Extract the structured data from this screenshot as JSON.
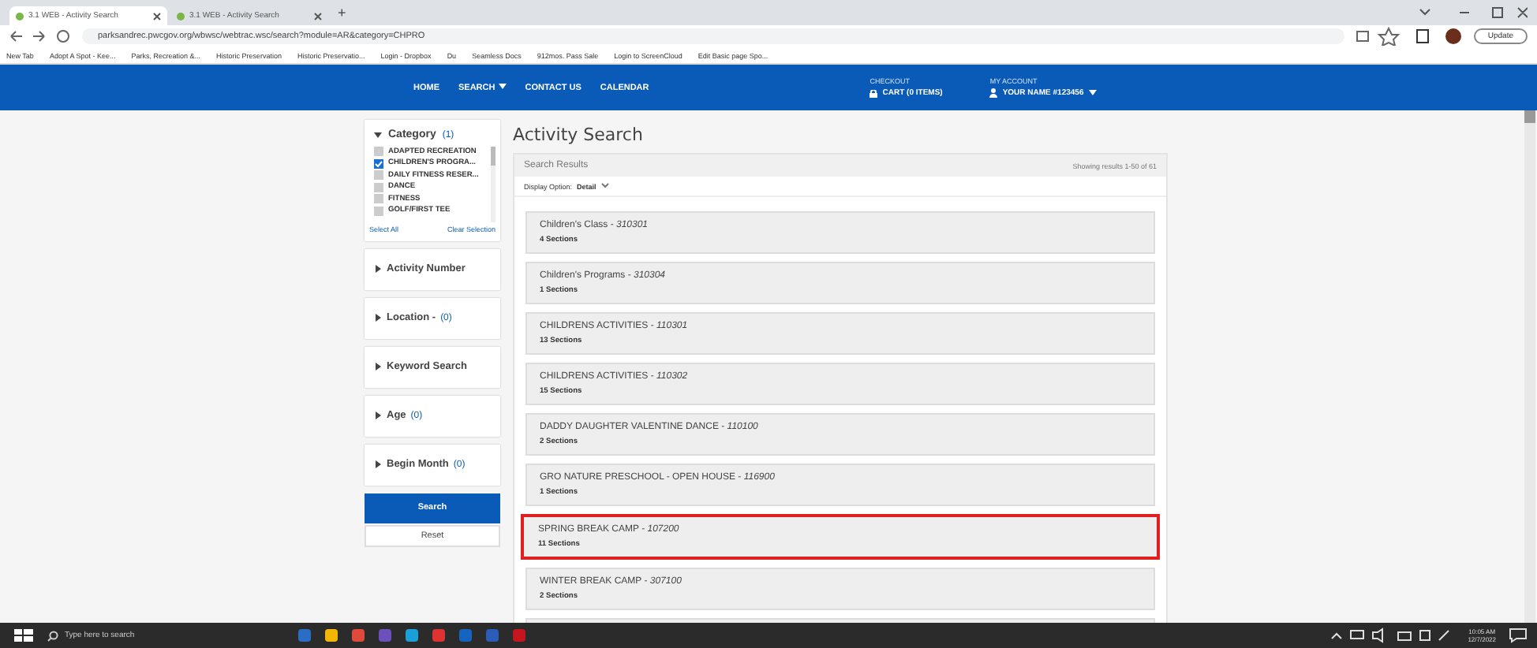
{
  "browser": {
    "tabs": [
      {
        "label": "3.1 WEB - Activity Search",
        "selected": true
      },
      {
        "label": "3.1 WEB - Activity Search",
        "selected": false
      }
    ],
    "new_tab": "+",
    "url": "parksandrec.pwcgov.org/wbwsc/webtrac.wsc/search?module=AR&category=CHPRO",
    "update_button": "Update",
    "bookmarks": [
      "New Tab",
      "Adopt A Spot - Kee...",
      "Parks, Recreation &...",
      "Historic Preservation",
      "Historic Preservatio...",
      "Login - Dropbox",
      "Du",
      "Seamless Docs",
      "912mos. Pass Sale",
      "Login to ScreenCloud",
      "Edit Basic page Spo..."
    ]
  },
  "nav": {
    "items": [
      {
        "label": "HOME",
        "dropdown": false
      },
      {
        "label": "SEARCH",
        "dropdown": true
      },
      {
        "label": "CONTACT US",
        "dropdown": false
      },
      {
        "label": "CALENDAR",
        "dropdown": false
      }
    ],
    "checkout": {
      "caption": "CHECKOUT",
      "label": "CART (0 ITEMS)"
    },
    "account": {
      "caption": "MY ACCOUNT",
      "label": "YOUR NAME #123456"
    }
  },
  "sidebar": {
    "category": {
      "title": "Category",
      "count": "(1)",
      "expanded": true,
      "options": [
        {
          "label": "ADAPTED RECREATION",
          "checked": false
        },
        {
          "label": "CHILDREN'S PROGRA...",
          "checked": true
        },
        {
          "label": "DAILY FITNESS RESER...",
          "checked": false
        },
        {
          "label": "DANCE",
          "checked": false
        },
        {
          "label": "FITNESS",
          "checked": false
        },
        {
          "label": "GOLF/FIRST TEE",
          "checked": false
        }
      ],
      "select_all": "Select All",
      "clear": "Clear Selection"
    },
    "filters": [
      {
        "title": "Activity Number",
        "expanded": false
      },
      {
        "title": "Location -",
        "count": "(0)",
        "expanded": false
      },
      {
        "title": "Keyword Search",
        "expanded": false
      },
      {
        "title": "Age",
        "count": "(0)",
        "expanded": false
      },
      {
        "title": "Begin Month",
        "count": "(0)",
        "expanded": false
      }
    ],
    "search_button": "Search",
    "reset_button": "Reset"
  },
  "main": {
    "title": "Activity Search",
    "results_label": "Search Results",
    "showing": "Showing results 1-50 of 61",
    "display_option_label": "Display Option:",
    "display_option": "Detail",
    "results": [
      {
        "name": "Children's Class - ",
        "code": "310301",
        "sections": "4 Sections",
        "highlighted": false
      },
      {
        "name": "Children's Programs - ",
        "code": "310304",
        "sections": "1 Sections",
        "highlighted": false
      },
      {
        "name": "CHILDRENS ACTIVITIES - ",
        "code": "110301",
        "sections": "13 Sections",
        "highlighted": false
      },
      {
        "name": "CHILDRENS ACTIVITIES - ",
        "code": "110302",
        "sections": "15 Sections",
        "highlighted": false
      },
      {
        "name": "DADDY DAUGHTER VALENTINE DANCE - ",
        "code": "110100",
        "sections": "2 Sections",
        "highlighted": false
      },
      {
        "name": "GRO NATURE PRESCHOOL - OPEN HOUSE - ",
        "code": "116900",
        "sections": "1 Sections",
        "highlighted": false
      },
      {
        "name": "SPRING BREAK CAMP - ",
        "code": "107200",
        "sections": "11 Sections",
        "highlighted": true
      },
      {
        "name": "WINTER BREAK CAMP - ",
        "code": "307100",
        "sections": "2 Sections",
        "highlighted": false
      }
    ]
  },
  "taskbar": {
    "search_placeholder": "Type here to search",
    "time": "10:05 AM",
    "date": "12/7/2022"
  }
}
